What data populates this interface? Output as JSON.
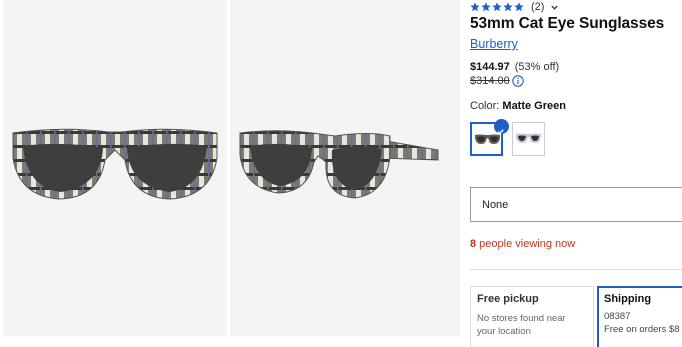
{
  "product": {
    "rating_stars": 5,
    "rating_count": "(2)",
    "title": "53mm Cat Eye Sunglasses",
    "brand": "Burberry",
    "price_sale": "$144.97",
    "price_off": "(53% off)",
    "price_original": "$314.00",
    "color_label": "Color:",
    "color_value": "Matte Green",
    "swatches": [
      {
        "icon": "sunglasses-swatch-icon",
        "selected": true
      },
      {
        "icon": "sunglasses-swatch-icon",
        "selected": false
      }
    ],
    "select_value": "None",
    "viewers_count": "8",
    "viewers_text": " people viewing now"
  },
  "fulfillment": {
    "pickup": {
      "title": "Free pickup",
      "line1": "No stores found near",
      "line2": "your location"
    },
    "shipping": {
      "title": "Shipping",
      "line1": "08387",
      "line2": "Free on orders $8"
    }
  },
  "colors": {
    "accent": "#1f60c4",
    "viewers": "#c8331c",
    "star": "#1f60c4"
  }
}
